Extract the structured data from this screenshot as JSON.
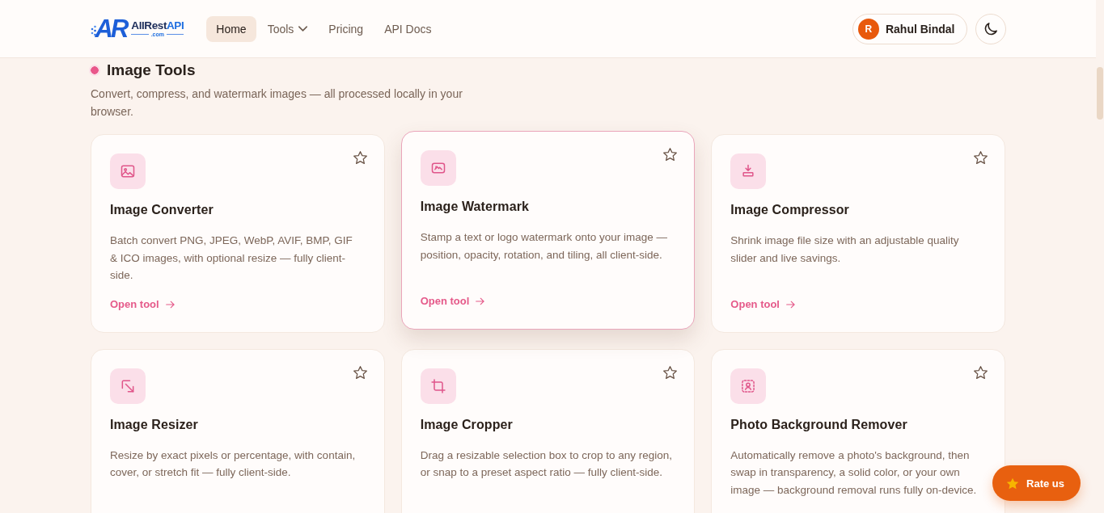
{
  "header": {
    "logo": {
      "mark": "AR",
      "name": "AllRest",
      "name_accent": "API",
      "domain": ".com"
    },
    "nav": [
      {
        "label": "Home",
        "selected": true,
        "dropdown": false
      },
      {
        "label": "Tools",
        "selected": false,
        "dropdown": true
      },
      {
        "label": "Pricing",
        "selected": false,
        "dropdown": false
      },
      {
        "label": "API Docs",
        "selected": false,
        "dropdown": false
      }
    ],
    "user": {
      "initial": "R",
      "name": "Rahul Bindal"
    }
  },
  "section": {
    "title": "Image Tools",
    "description": "Convert, compress, and watermark images — all processed locally in your browser."
  },
  "tools": [
    {
      "kind": "converter",
      "title": "Image Converter",
      "description": "Batch convert PNG, JPEG, WebP, AVIF, BMP, GIF & ICO images, with optional resize — fully client-side.",
      "link": "Open tool",
      "highlighted": false,
      "favorite": false
    },
    {
      "kind": "watermark",
      "title": "Image Watermark",
      "description": "Stamp a text or logo watermark onto your image — position, opacity, rotation, and tiling, all client-side.",
      "link": "Open tool",
      "highlighted": true,
      "favorite": false
    },
    {
      "kind": "compressor",
      "title": "Image Compressor",
      "description": "Shrink image file size with an adjustable quality slider and live savings.",
      "link": "Open tool",
      "highlighted": false,
      "favorite": false
    },
    {
      "kind": "resizer",
      "title": "Image Resizer",
      "description": "Resize by exact pixels or percentage, with contain, cover, or stretch fit — fully client-side.",
      "highlighted": false,
      "favorite": false
    },
    {
      "kind": "cropper",
      "title": "Image Cropper",
      "description": "Drag a resizable selection box to crop to any region, or snap to a preset aspect ratio — fully client-side.",
      "highlighted": false,
      "favorite": false
    },
    {
      "kind": "remover",
      "title": "Photo Background Remover",
      "description": "Automatically remove a photo's background, then swap in transparency, a solid color, or your own image — background removal runs fully on-device.",
      "highlighted": false,
      "favorite": false
    }
  ],
  "rate_button": {
    "label": "Rate us"
  }
}
